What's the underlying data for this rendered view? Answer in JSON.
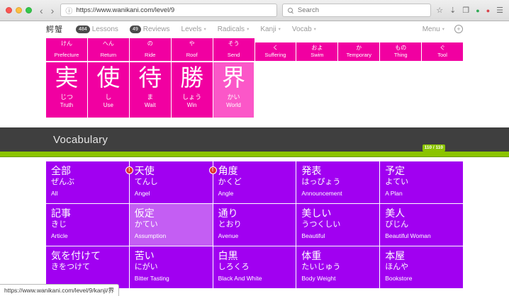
{
  "browser": {
    "back_glyph": "‹",
    "forward_glyph": "›",
    "url_info_glyph": "ⓘ",
    "url": "https://www.wanikani.com/level/9",
    "search_placeholder": "Search",
    "toolbar_icons": {
      "bookmark": "☆",
      "download": "⇣",
      "sidebar": "❐",
      "menu": "☰",
      "ext_green": "●",
      "ext_red": "●"
    },
    "status_link": "https://www.wanikani.com/level/9/kanji/界"
  },
  "nav": {
    "logo": "鰐蟹",
    "caret": "▾",
    "lessons_badge": "484",
    "lessons_label": "Lessons",
    "reviews_badge": "49",
    "reviews_label": "Reviews",
    "items": [
      {
        "label": "Levels"
      },
      {
        "label": "Radicals"
      },
      {
        "label": "Kanji"
      },
      {
        "label": "Vocab"
      }
    ],
    "menu_label": "Menu",
    "add_glyph": "+"
  },
  "kanji_small": [
    {
      "reading": "けん",
      "meaning": "Prefecture"
    },
    {
      "reading": "へん",
      "meaning": "Return"
    },
    {
      "reading": "の",
      "meaning": "Ride"
    },
    {
      "reading": "や",
      "meaning": "Roof"
    },
    {
      "reading": "そう",
      "meaning": "Send"
    },
    {
      "reading": "く",
      "meaning": "Suffering"
    },
    {
      "reading": "およ",
      "meaning": "Swim"
    },
    {
      "reading": "か",
      "meaning": "Temporary"
    },
    {
      "reading": "もの",
      "meaning": "Thing"
    },
    {
      "reading": "ぐ",
      "meaning": "Tool"
    }
  ],
  "kanji_large": [
    {
      "character": "実",
      "reading": "じつ",
      "meaning": "Truth"
    },
    {
      "character": "使",
      "reading": "し",
      "meaning": "Use"
    },
    {
      "character": "待",
      "reading": "ま",
      "meaning": "Wait"
    },
    {
      "character": "勝",
      "reading": "しょう",
      "meaning": "Win"
    },
    {
      "character": "界",
      "reading": "かい",
      "meaning": "World"
    }
  ],
  "vocabulary": {
    "section_title": "Vocabulary",
    "alert_badge": "!",
    "progress": {
      "label": "110 / 110",
      "percent": 100
    },
    "tiles": [
      {
        "word": "全部",
        "reading": "ぜんぶ",
        "meaning": "All"
      },
      {
        "word": "天使",
        "reading": "てんし",
        "meaning": "Angel"
      },
      {
        "word": "角度",
        "reading": "かくど",
        "meaning": "Angle"
      },
      {
        "word": "発表",
        "reading": "はっぴょう",
        "meaning": "Announcement"
      },
      {
        "word": "予定",
        "reading": "よてい",
        "meaning": "A Plan"
      },
      {
        "word": "記事",
        "reading": "きじ",
        "meaning": "Article"
      },
      {
        "word": "仮定",
        "reading": "かてい",
        "meaning": "Assumption"
      },
      {
        "word": "通り",
        "reading": "とおり",
        "meaning": "Avenue"
      },
      {
        "word": "美しい",
        "reading": "うつくしい",
        "meaning": "Beautiful"
      },
      {
        "word": "美人",
        "reading": "びじん",
        "meaning": "Beautiful Woman"
      },
      {
        "word": "気を付けて",
        "reading": "きをつけて",
        "meaning": ""
      },
      {
        "word": "苦い",
        "reading": "にがい",
        "meaning": "Bitter Tasting"
      },
      {
        "word": "白黒",
        "reading": "しろくろ",
        "meaning": "Black And White"
      },
      {
        "word": "体重",
        "reading": "たいじゅう",
        "meaning": "Body Weight"
      },
      {
        "word": "本屋",
        "reading": "ほんや",
        "meaning": "Bookstore"
      }
    ]
  },
  "colors": {
    "kanji_pink": "#f100a1",
    "kanji_pink_light": "#fb57c8",
    "vocab_purple": "#a100f1",
    "vocab_purple_light": "#c45ef3",
    "progress_green": "#8bc400",
    "header_gray": "#3f3f3f"
  }
}
